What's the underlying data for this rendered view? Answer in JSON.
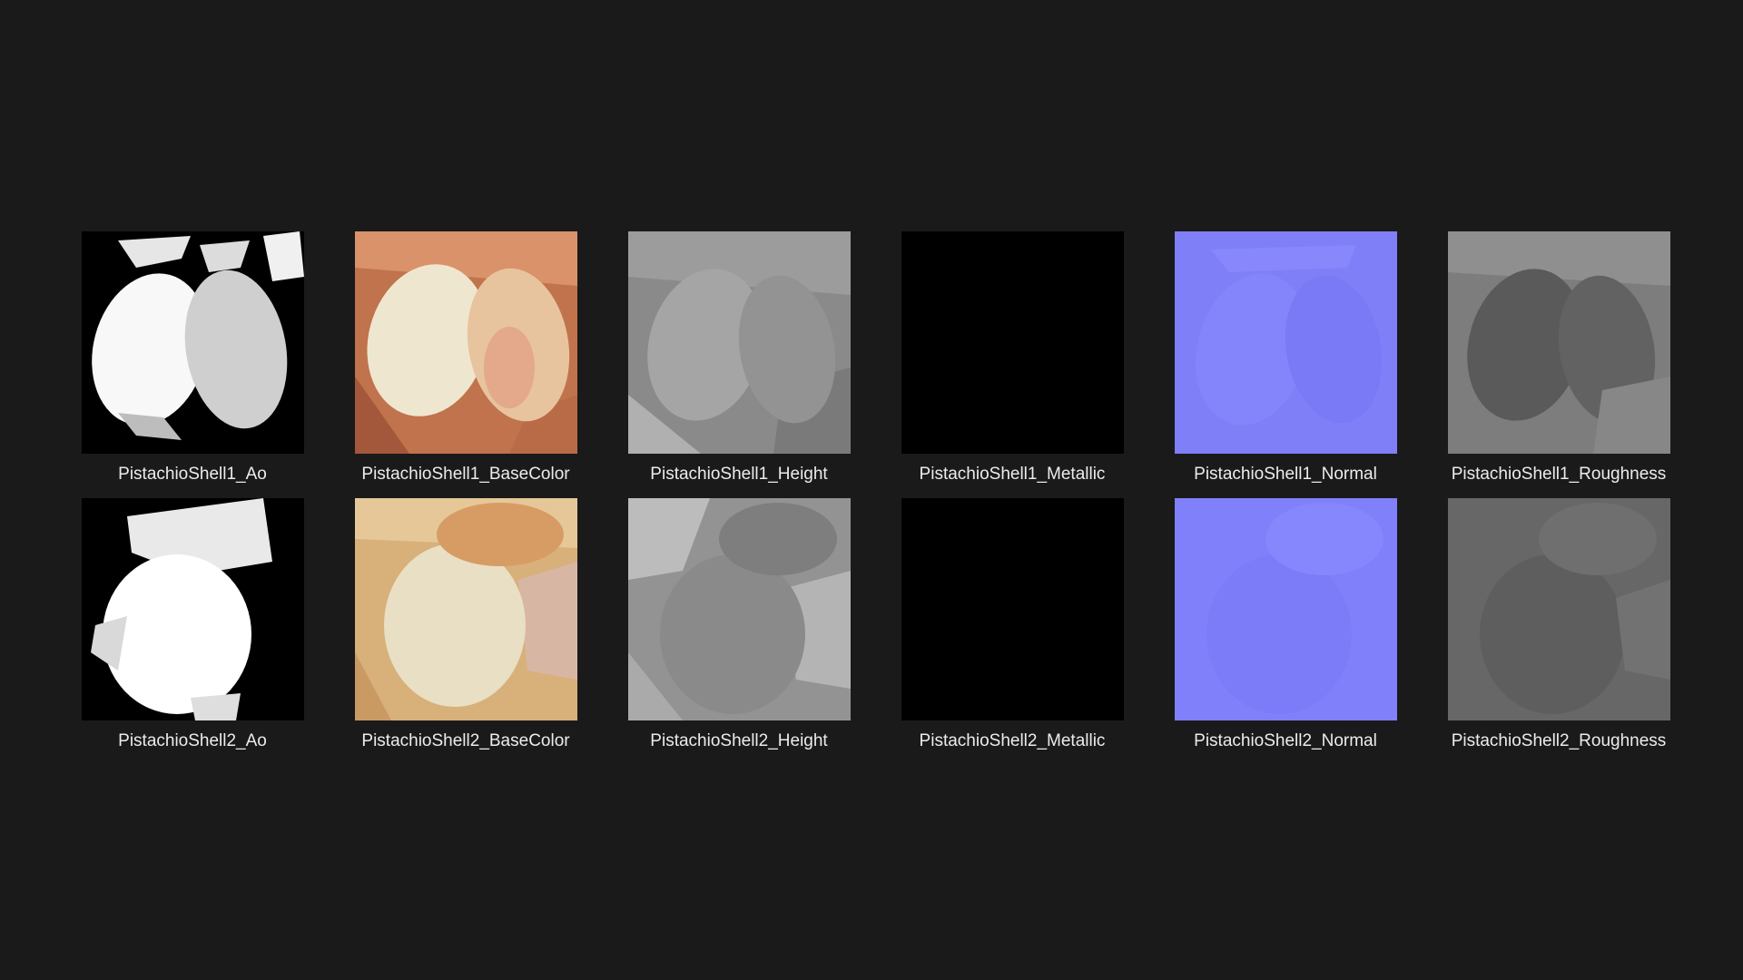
{
  "files": [
    {
      "name": "PistachioShell1_Ao",
      "kind": "ao",
      "variant": 1
    },
    {
      "name": "PistachioShell1_BaseColor",
      "kind": "basecolor",
      "variant": 1
    },
    {
      "name": "PistachioShell1_Height",
      "kind": "height",
      "variant": 1
    },
    {
      "name": "PistachioShell1_Metallic",
      "kind": "metallic",
      "variant": 1
    },
    {
      "name": "PistachioShell1_Normal",
      "kind": "normal",
      "variant": 1
    },
    {
      "name": "PistachioShell1_Roughness",
      "kind": "roughness",
      "variant": 1
    },
    {
      "name": "PistachioShell2_Ao",
      "kind": "ao",
      "variant": 2
    },
    {
      "name": "PistachioShell2_BaseColor",
      "kind": "basecolor",
      "variant": 2
    },
    {
      "name": "PistachioShell2_Height",
      "kind": "height",
      "variant": 2
    },
    {
      "name": "PistachioShell2_Metallic",
      "kind": "metallic",
      "variant": 2
    },
    {
      "name": "PistachioShell2_Normal",
      "kind": "normal",
      "variant": 2
    },
    {
      "name": "PistachioShell2_Roughness",
      "kind": "roughness",
      "variant": 2
    }
  ],
  "colors": {
    "background": "#1a1a1a",
    "caption": "#ececec",
    "normal_base": "#8080ff"
  }
}
